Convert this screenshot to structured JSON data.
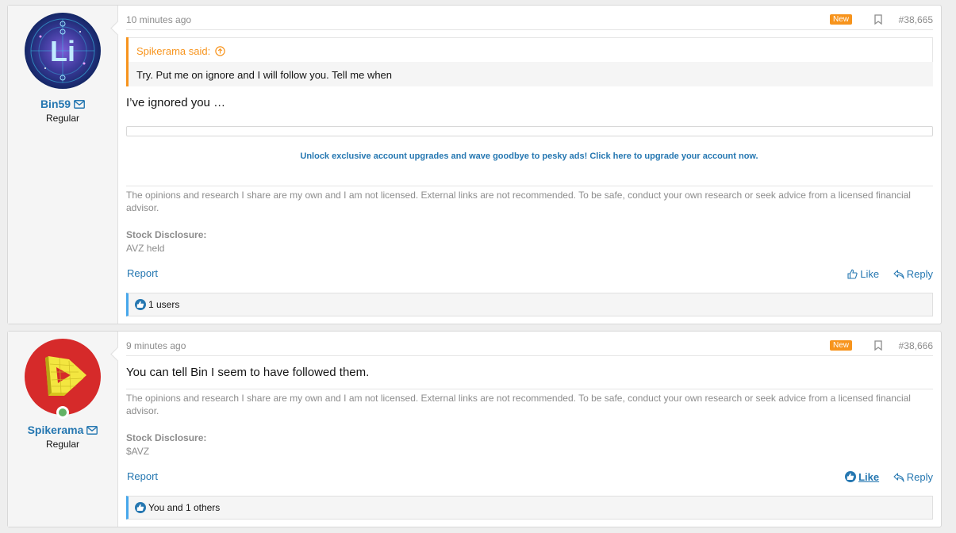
{
  "posts": [
    {
      "username": "Bin59",
      "user_title": "Regular",
      "avatar_letter": "Li",
      "avatar_colors": [
        "#1d2f6e",
        "#6a4ab0",
        "#23b5d8"
      ],
      "time": "10 minutes ago",
      "new_badge": "New",
      "post_number": "#38,665",
      "quote": {
        "author": "Spikerama said:",
        "text": "Try. Put me on ignore and I will follow you. Tell me when"
      },
      "message": "I’ve ignored you …",
      "ad_text": "Unlock exclusive account upgrades and wave goodbye to pesky ads! Click here to upgrade your account now.",
      "signature": "The opinions and research I share are my own and I am not licensed. External links are not recommended. To be safe, conduct your own research or seek advice from a licensed financial advisor.",
      "disclosure_label": "Stock Disclosure:",
      "disclosure_value": "AVZ held",
      "report": "Report",
      "like": "Like",
      "reply": "Reply",
      "reactions": "1 users"
    },
    {
      "username": "Spikerama",
      "user_title": "Regular",
      "avatar_colors": [
        "#d62a2a",
        "#f2e33a",
        "#c9b81f"
      ],
      "online": true,
      "time": "9 minutes ago",
      "new_badge": "New",
      "post_number": "#38,666",
      "message": "You can tell Bin I seem to have followed them.",
      "signature": "The opinions and research I share are my own and I am not licensed. External links are not recommended. To be safe, conduct your own research or seek advice from a licensed financial advisor.",
      "disclosure_label": "Stock Disclosure:",
      "disclosure_value": "$AVZ",
      "report": "Report",
      "like": "Like",
      "reply": "Reply",
      "reactions": "You and 1 others"
    }
  ],
  "colors": {
    "link": "#2577b1",
    "badge": "#f7941d",
    "online": "#63b265"
  }
}
